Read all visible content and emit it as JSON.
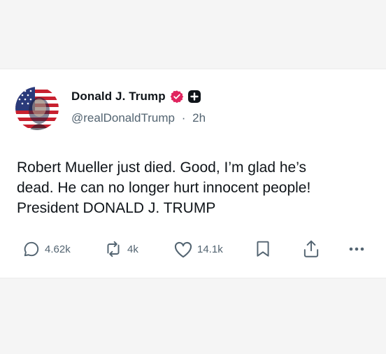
{
  "tweet": {
    "author": {
      "display_name": "Donald J. Trump",
      "handle": "@realDonaldTrump",
      "time": "2h",
      "separator": "·",
      "avatar_icon": "flag-portrait-avatar",
      "verified_icon": "verified-badge-icon",
      "org_icon": "plus-badge-icon"
    },
    "text_lines": [
      "Robert Mueller just died. Good, I’m glad he’s",
      "dead. He can no longer hurt innocent people!",
      "President DONALD J. TRUMP"
    ],
    "actions": {
      "replies": {
        "icon": "reply-icon",
        "count": "4.62k"
      },
      "reposts": {
        "icon": "repost-icon",
        "count": "4k"
      },
      "likes": {
        "icon": "heart-icon",
        "count": "14.1k"
      },
      "bookmark": {
        "icon": "bookmark-icon"
      },
      "share": {
        "icon": "share-icon"
      },
      "more": {
        "icon": "more-icon"
      }
    }
  },
  "colors": {
    "text_primary": "#0f1419",
    "text_secondary": "#536471",
    "verified_pink": "#e0245e",
    "background": "#f5f5f5",
    "card": "#ffffff"
  }
}
